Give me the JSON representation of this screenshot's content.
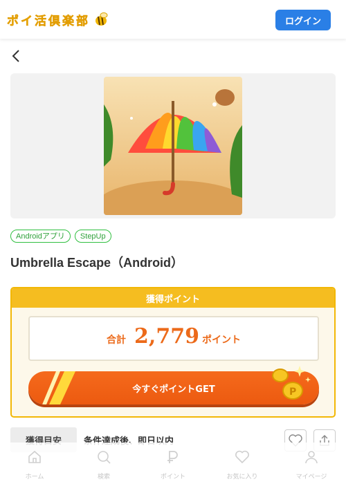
{
  "header": {
    "logo_text": "ポイ活倶楽部",
    "login_label": "ログイン"
  },
  "offer": {
    "tags": [
      "Androidアプリ",
      "StepUp"
    ],
    "title": "Umbrella Escape（Android）"
  },
  "points": {
    "heading": "獲得ポイント",
    "total_label": "合計",
    "total_value": "2,779",
    "unit": "ポイント",
    "cta_label": "今すぐポイントGET"
  },
  "info": {
    "label": "獲得目安",
    "value": "条件達成後、即日以内"
  },
  "nav": {
    "items": [
      {
        "label": "ホーム",
        "icon": "home-icon"
      },
      {
        "label": "検索",
        "icon": "search-icon"
      },
      {
        "label": "ポイント",
        "icon": "points-icon"
      },
      {
        "label": "お気に入り",
        "icon": "heart-icon"
      },
      {
        "label": "マイページ",
        "icon": "user-icon"
      }
    ]
  },
  "colors": {
    "accent_blue": "#2a7fe6",
    "accent_orange": "#ec5a10",
    "accent_yellow": "#f5bd20",
    "tag_green": "#2fbf3f"
  }
}
